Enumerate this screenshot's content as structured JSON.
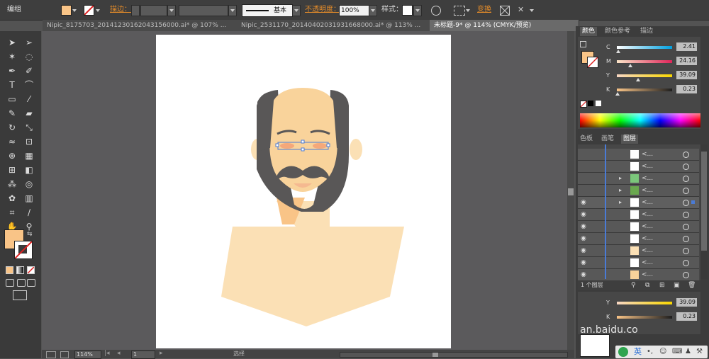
{
  "control_bar": {
    "group_label": "编组",
    "stroke_label": "描边：",
    "stroke_style": "基本",
    "opacity_label": "不透明度：",
    "opacity_value": "100%",
    "style_label": "样式：",
    "transform_label": "变换"
  },
  "tabs": [
    {
      "label": "Nipic_8175703_20141230162043156000.ai* @ 107% ...",
      "active": false
    },
    {
      "label": "Nipic_2531170_20140402031931668000.ai* @ 113% ...",
      "active": false
    },
    {
      "label": "未标题-9* @ 114% (CMYK/预览)",
      "active": true
    }
  ],
  "color_panel": {
    "tabs": [
      "颜色",
      "颜色参考",
      "描边"
    ],
    "channels": [
      {
        "name": "C",
        "value": "2.41",
        "pct": 0.03
      },
      {
        "name": "M",
        "value": "24.16",
        "pct": 0.24
      },
      {
        "name": "Y",
        "value": "39.09",
        "pct": 0.39
      },
      {
        "name": "K",
        "value": "0.23",
        "pct": 0.01
      }
    ],
    "fill_color": "#f9c487"
  },
  "layers_panel": {
    "tabs": [
      "色板",
      "画笔",
      "图层"
    ],
    "status": "1 个图层"
  },
  "lower_panel": {
    "channels": [
      {
        "name": "Y",
        "value": "39.09"
      },
      {
        "name": "K",
        "value": "0.23"
      }
    ]
  },
  "status_bar": {
    "zoom": "114%",
    "page": "1",
    "tool": "选择"
  },
  "watermark": "an.baidu.co",
  "ime": "英"
}
